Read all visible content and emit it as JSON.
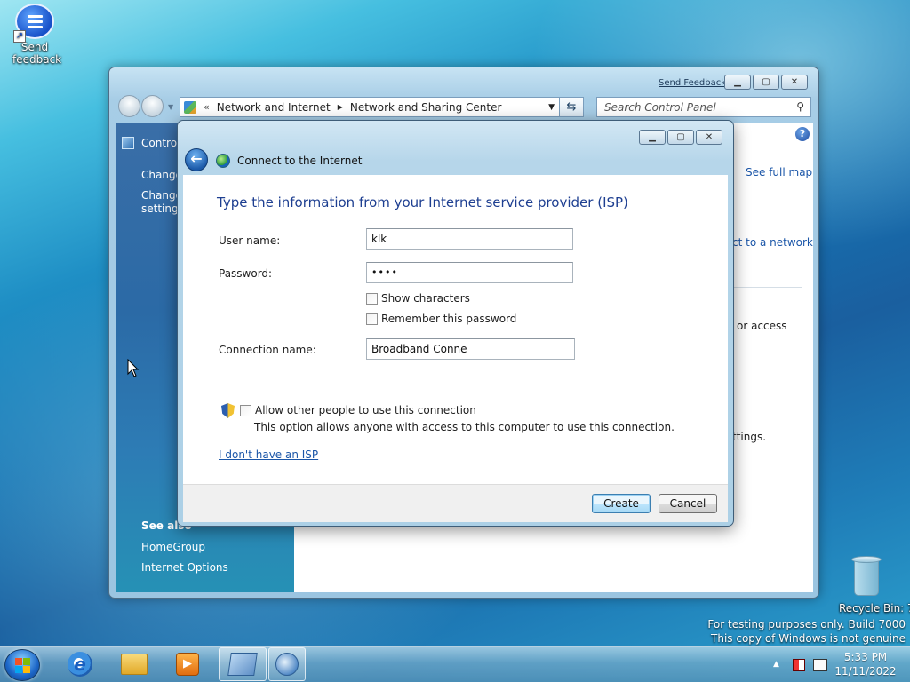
{
  "desktop": {
    "feedback_icon_label": "Send feedback",
    "recycle_bin_label": "Recycle Bin: 7",
    "watermark_line1": "For testing purposes only. Build 7000",
    "watermark_line2": "This copy of Windows is not genuine"
  },
  "control_panel": {
    "send_feedback": "Send Feedback",
    "breadcrumb": {
      "chevrons": "«",
      "items": [
        "Network and Internet",
        "Network and Sharing Center"
      ]
    },
    "search_placeholder": "Search Control Panel",
    "sidebar": {
      "home": "Control",
      "links": [
        "Change",
        "Change\nsettings"
      ],
      "see_also": "See also",
      "see_also_links": [
        "HomeGroup",
        "Internet Options"
      ]
    },
    "main": {
      "see_full_map": "See full map",
      "connect_link": "ct to a network",
      "or_access": "or access",
      "settings_fragment": "ttings."
    }
  },
  "dialog": {
    "title": "Connect to the Internet",
    "heading": "Type the information from your Internet service provider (ISP)",
    "username_label": "User name:",
    "username_value": "klk",
    "password_label": "Password:",
    "password_value": "••••",
    "show_characters": "Show characters",
    "remember_password": "Remember this password",
    "connection_name_label": "Connection name:",
    "connection_name_value": "Broadband Conne",
    "allow_others": "Allow other people to use this connection",
    "allow_others_desc": "This option allows anyone with access to this computer to use this connection.",
    "no_isp_link": "I don't have an ISP",
    "create_button": "Create",
    "cancel_button": "Cancel"
  },
  "taskbar": {
    "time": "5:33 PM",
    "date": "11/11/2022",
    "apps": [
      "internet-explorer-icon",
      "folder-icon",
      "media-player-icon",
      "control-panel-icon",
      "network-icon"
    ]
  },
  "colors": {
    "accent_blue": "#1e3f91",
    "link_blue": "#1b56a8",
    "sidebar_blue": "#2b6aa6"
  }
}
